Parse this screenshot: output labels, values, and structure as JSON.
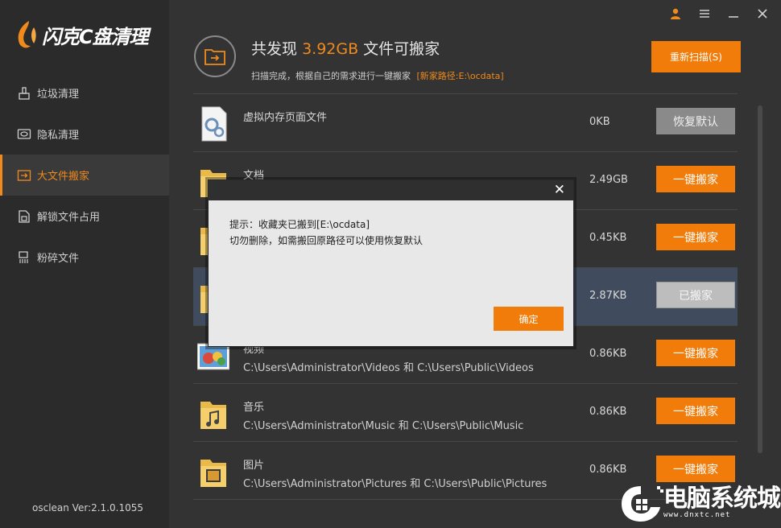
{
  "app": {
    "logo_text": "闪克C盘清理",
    "version": "osclean Ver:2.1.0.1055"
  },
  "sidebar": {
    "items": [
      {
        "label": "垃圾清理",
        "icon": "broom-icon",
        "active": false
      },
      {
        "label": "隐私清理",
        "icon": "privacy-icon",
        "active": false
      },
      {
        "label": "大文件搬家",
        "icon": "move-file-icon",
        "active": true
      },
      {
        "label": "解锁文件占用",
        "icon": "unlock-file-icon",
        "active": false
      },
      {
        "label": "粉碎文件",
        "icon": "shred-icon",
        "active": false
      }
    ]
  },
  "topbar": {
    "icons": [
      "user-icon",
      "menu-icon",
      "minimize-icon",
      "close-icon"
    ]
  },
  "header": {
    "summary_prefix": "共发现",
    "summary_size": "3.92GB",
    "summary_suffix": "文件可搬家",
    "subtext": "扫描完成，根据自己的需求进行一键搬家",
    "new_path": "[新家路径:E:\\ocdata]",
    "rescan_label": "重新扫描(S)"
  },
  "rows": [
    {
      "name": "虚拟内存页面文件",
      "path": "",
      "size": "0KB",
      "button": "恢复默认",
      "icon": "pagefile-icon"
    },
    {
      "name": "文档",
      "path": "",
      "size": "2.49GB",
      "button": "一键搬家",
      "icon": "folder-icon"
    },
    {
      "name": "",
      "path": "",
      "size": "0.45KB",
      "button": "一键搬家",
      "icon": "folder-icon"
    },
    {
      "name": "",
      "path": "",
      "size": "2.87KB",
      "button": "已搬家",
      "icon": "folder-icon"
    },
    {
      "name": "视频",
      "path": "C:\\Users\\Administrator\\Videos 和 C:\\Users\\Public\\Videos",
      "size": "0.86KB",
      "button": "一键搬家",
      "icon": "video-folder-icon"
    },
    {
      "name": "音乐",
      "path": "C:\\Users\\Administrator\\Music 和 C:\\Users\\Public\\Music",
      "size": "0.86KB",
      "button": "一键搬家",
      "icon": "music-folder-icon"
    },
    {
      "name": "图片",
      "path": "C:\\Users\\Administrator\\Pictures 和 C:\\Users\\Public\\Pictures",
      "size": "0.86KB",
      "button": "一键搬家",
      "icon": "picture-folder-icon"
    }
  ],
  "dialog": {
    "line1": "提示：收藏夹已搬到[E:\\ocdata]",
    "line2": "切勿删除，如需搬回原路径可以使用恢复默认",
    "ok_label": "确定"
  },
  "watermark": {
    "text": "电脑系统城",
    "url": "www.dnxtc.net"
  },
  "colors": {
    "accent": "#f27c09",
    "sidebar_bg": "#2b2b2b",
    "main_bg": "#333333",
    "highlight_row": "#404b5e"
  }
}
